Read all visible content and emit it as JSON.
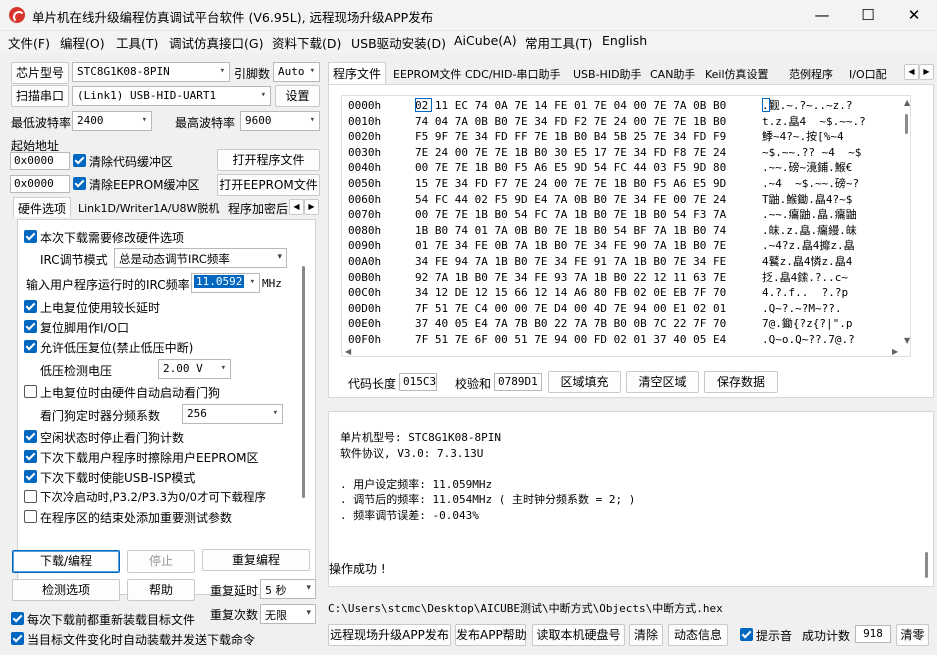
{
  "window": {
    "title": "单片机在线升级编程仿真调试平台软件 (V6.95L), 远程现场升级APP发布",
    "min": "—",
    "max": "☐",
    "close": "✕"
  },
  "menu": [
    "文件(F)",
    "编程(O)",
    "工具(T)",
    "调试仿真接口(G)",
    "资料下载(D)",
    "USB驱动安装(D)",
    "AiCube(A)",
    "常用工具(T)",
    "English"
  ],
  "left": {
    "chip_label": "芯片型号",
    "chip_value": "STC8G1K08-8PIN",
    "pin_label": "引脚数",
    "pin_value": "Auto",
    "scan_button": "扫描串口",
    "port_value": "(Link1) USB-HID-UART1",
    "settings_button": "设置",
    "min_baud_label": "最低波特率",
    "min_baud_value": "2400",
    "max_baud_label": "最高波特率",
    "max_baud_value": "9600",
    "start_addr_label": "起始地址",
    "addr1": "0x0000",
    "clear_code_buffer": "清除代码缓冲区",
    "open_program_file": "打开程序文件",
    "addr2": "0x0000",
    "clear_eeprom_buffer": "清除EEPROM缓冲区",
    "open_eeprom_file": "打开EEPROM文件",
    "tabs": [
      "硬件选项",
      "Link1D/Writer1A/U8W脱机",
      "程序加密后"
    ],
    "options": {
      "opt1": "本次下载需要修改硬件选项",
      "irc_mode_label": "IRC调节模式",
      "irc_mode_value": "总是动态调节IRC频率",
      "irc_freq_label": "输入用户程序运行时的IRC频率",
      "irc_freq_value": "11.0592",
      "irc_freq_unit": "MHz",
      "opt_power_delay": "上电复位使用较长延时",
      "opt_reset_pin": "复位脚用作I/O口",
      "opt_lvd": "允许低压复位(禁止低压中断)",
      "lvd_label": "低压检测电压",
      "lvd_value": "2.00 V",
      "opt_wdt": "上电复位时由硬件自动启动看门狗",
      "wdt_div_label": "看门狗定时器分频系数",
      "wdt_div_value": "256",
      "opt_idle_wdt": "空闲状态时停止看门狗计数",
      "opt_erase_eeprom": "下次下载用户程序时擦除用户EEPROM区",
      "opt_usb_isp": "下次下载时使能USB-ISP模式",
      "opt_p32p33": "下次冷启动时,P3.2/P3.3为0/0才可下载程序",
      "opt_test_param": "在程序区的结束处添加重要测试参数"
    },
    "download_button": "下载/编程",
    "stop_button": "停止",
    "reprogram_button": "重复编程",
    "check_button": "检测选项",
    "help_button": "帮助",
    "repeat_delay_label": "重复延时",
    "repeat_delay_value": "5 秒",
    "repeat_count_label": "重复次数",
    "repeat_count_value": "无限",
    "reload_before": "每次下载前都重新装载目标文件",
    "auto_download": "当目标文件变化时自动装载并发送下载命令"
  },
  "right": {
    "tabs": [
      "程序文件",
      "EEPROM文件",
      "CDC/HID-串口助手",
      "USB-HID助手",
      "CAN助手",
      "Keil仿真设置",
      "范例程序",
      "I/O口配"
    ],
    "hex_rows": [
      {
        "addr": "0000h",
        "bytes": "02 11 EC 74 0A 7E 14 FE 01 7E 04 00 7E 7A 0B B0",
        "ascii": ".觐.~.?~..~z.?"
      },
      {
        "addr": "0010h",
        "bytes": "74 04 7A 0B B0 7E 34 FD F2 7E 24 00 7E 7E 1B B0",
        "ascii": "t.z.皛4  ~$.~~.?"
      },
      {
        "addr": "0020h",
        "bytes": "F5 9F 7E 34 FD FF 7E 1B B0 B4 5B 25 7E 34 FD F9",
        "ascii": "鯚~4?~.按[%~4"
      },
      {
        "addr": "0030h",
        "bytes": "7E 24 00 7E 7E 1B B0 30 E5 17 7E 34 FD F8 7E 24",
        "ascii": "~$.~~.?? ~4  ~$"
      },
      {
        "addr": "0040h",
        "bytes": "00 7E 7E 1B B0 F5 A6 E5 9D 54 FC 44 03 F5 9D 80",
        "ascii": ".~~.磅~滰鋪.鯸€"
      },
      {
        "addr": "0050h",
        "bytes": "15 7E 34 FD F7 7E 24 00 7E 7E 1B B0 F5 A6 E5 9D",
        "ascii": ".~4  ~$.~~.磅~?"
      },
      {
        "addr": "0060h",
        "bytes": "54 FC 44 02 F5 9D E4 7A 0B B0 7E 34 FE 00 7E 24",
        "ascii": "T鼬.鯸鋤.皛4?~$"
      },
      {
        "addr": "0070h",
        "bytes": "00 7E 7E 1B B0 54 FC 7A 1B B0 7E 1B B0 54 F3 7A",
        "ascii": ".~~.癟鼬.皛.癟鼬"
      },
      {
        "addr": "0080h",
        "bytes": "1B B0 74 01 7A 0B B0 7E 1B B0 54 BF 7A 1B B0 74",
        "ascii": ".皌.z.皛.癟縵.皌"
      },
      {
        "addr": "0090h",
        "bytes": "01 7E 34 FE 0B 7A 1B B0 7E 34 FE 90 7A 1B B0 7E",
        "ascii": ".~4?z.皛4攠z.皛"
      },
      {
        "addr": "00A0h",
        "bytes": "34 FE 94 7A 1B B0 7E 34 FE 91 7A 1B B0 7E 34 FE",
        "ascii": "4鼚z.皛4憐z.皛4"
      },
      {
        "addr": "00B0h",
        "bytes": "92 7A 1B B0 7E 34 FE 93 7A 1B B0 22 12 11 63 7E",
        "ascii": "抸.皛4鎍.?..c~"
      },
      {
        "addr": "00C0h",
        "bytes": "34 12 DE 12 15 66 12 14 A6 80 FB 02 0E EB 7F 70",
        "ascii": "4.?.f..  ?.?p"
      },
      {
        "addr": "00D0h",
        "bytes": "7F 51 7E C4 00 00 7E D4 00 4D 7E 94 00 E1 02 01",
        "ascii": ".Q~?.~?M~??."
      },
      {
        "addr": "00E0h",
        "bytes": "37 40 05 E4 7A 7B B0 22 7A 7B B0 0B 7C 22 7F 70",
        "ascii": "7@.鋤{?z{?|\".p"
      },
      {
        "addr": "00F0h",
        "bytes": "7F 51 7E 6F 00 51 7E 94 00 FD 02 01 37 40 05 E4",
        "ascii": ".Q~o.Q~??.7@.?"
      }
    ],
    "code_len_label": "代码长度",
    "code_len_value": "015C3",
    "checksum_label": "校验和",
    "checksum_value": "0789D1",
    "fill_button": "区域填充",
    "clear_area_button": "清空区域",
    "save_button": "保存数据",
    "log": [
      "单片机型号: STC8G1K08-8PIN",
      "软件协议, V3.0: 7.3.13U",
      "",
      ". 用户设定频率: 11.059MHz",
      ". 调节后的频率: 11.054MHz ( 主时钟分频系数 = 2; )",
      ". 频率调节误差: -0.043%"
    ],
    "log_result": "操作成功 !",
    "file_path": "C:\\Users\\stcmc\\Desktop\\AICUBE测试\\中断方式\\Objects\\中断方式.hex",
    "bottom_buttons": [
      "远程现场升级APP发布",
      "发布APP帮助",
      "读取本机硬盘号",
      "清除",
      "动态信息"
    ],
    "beep_label": "提示音",
    "success_label": "成功计数",
    "success_value": "918",
    "clear_count_button": "清零"
  },
  "icons": {
    "tab_left": "◀",
    "tab_right": "▶",
    "dropdown": "▾"
  }
}
